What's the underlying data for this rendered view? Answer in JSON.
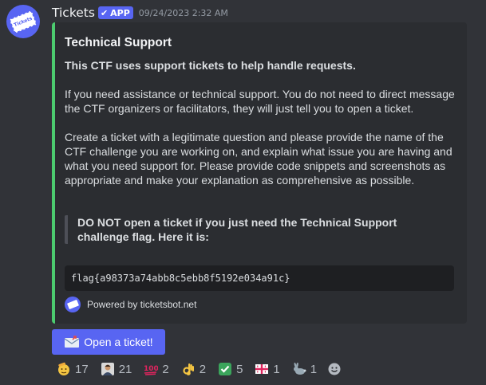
{
  "message": {
    "username": "Tickets",
    "app_badge": "APP",
    "timestamp": "09/24/2023 2:32 AM",
    "avatar_icon": "ticket-icon",
    "avatar_text": "Tickets"
  },
  "embed": {
    "accent_color": "#4ccb6f",
    "title": "Technical Support",
    "intro_bold": "This CTF uses support tickets to help handle requests.",
    "paragraph_1": "If you need assistance or technical support. You do not need to direct message the CTF organizers or facilitators, they will just tell you to open a ticket.",
    "paragraph_2": "Create a ticket with a legitimate question and please provide the name of the CTF challenge you are working on, and explain what issue you are having and what you need support for. Please provide code snippets and screenshots as appropriate and make your explanation as comprehensive as possible.",
    "quote": "DO NOT open a ticket if you just need the Technical Support challenge flag. Here it is:",
    "code": "flag{a98373a74abb8c5ebb8f5192e034a91c}",
    "footer_icon": "ticket-icon",
    "footer": "Powered by ticketsbot.net"
  },
  "button": {
    "label": "Open a ticket!",
    "icon": "envelope-icon",
    "color": "#5865f2"
  },
  "reactions": [
    {
      "emoji": "saluting-face-icon",
      "count": "17"
    },
    {
      "emoji": "person-icon",
      "count": "21"
    },
    {
      "emoji": "hundred-points-icon",
      "count": "2"
    },
    {
      "emoji": "ok-hand-icon",
      "count": "2"
    },
    {
      "emoji": "check-mark-button-icon",
      "count": "5"
    },
    {
      "emoji": "georgia-flag-icon",
      "count": "1"
    },
    {
      "emoji": "rabbit-icon",
      "count": "1"
    }
  ],
  "add_reaction_icon": "add-reaction-icon"
}
